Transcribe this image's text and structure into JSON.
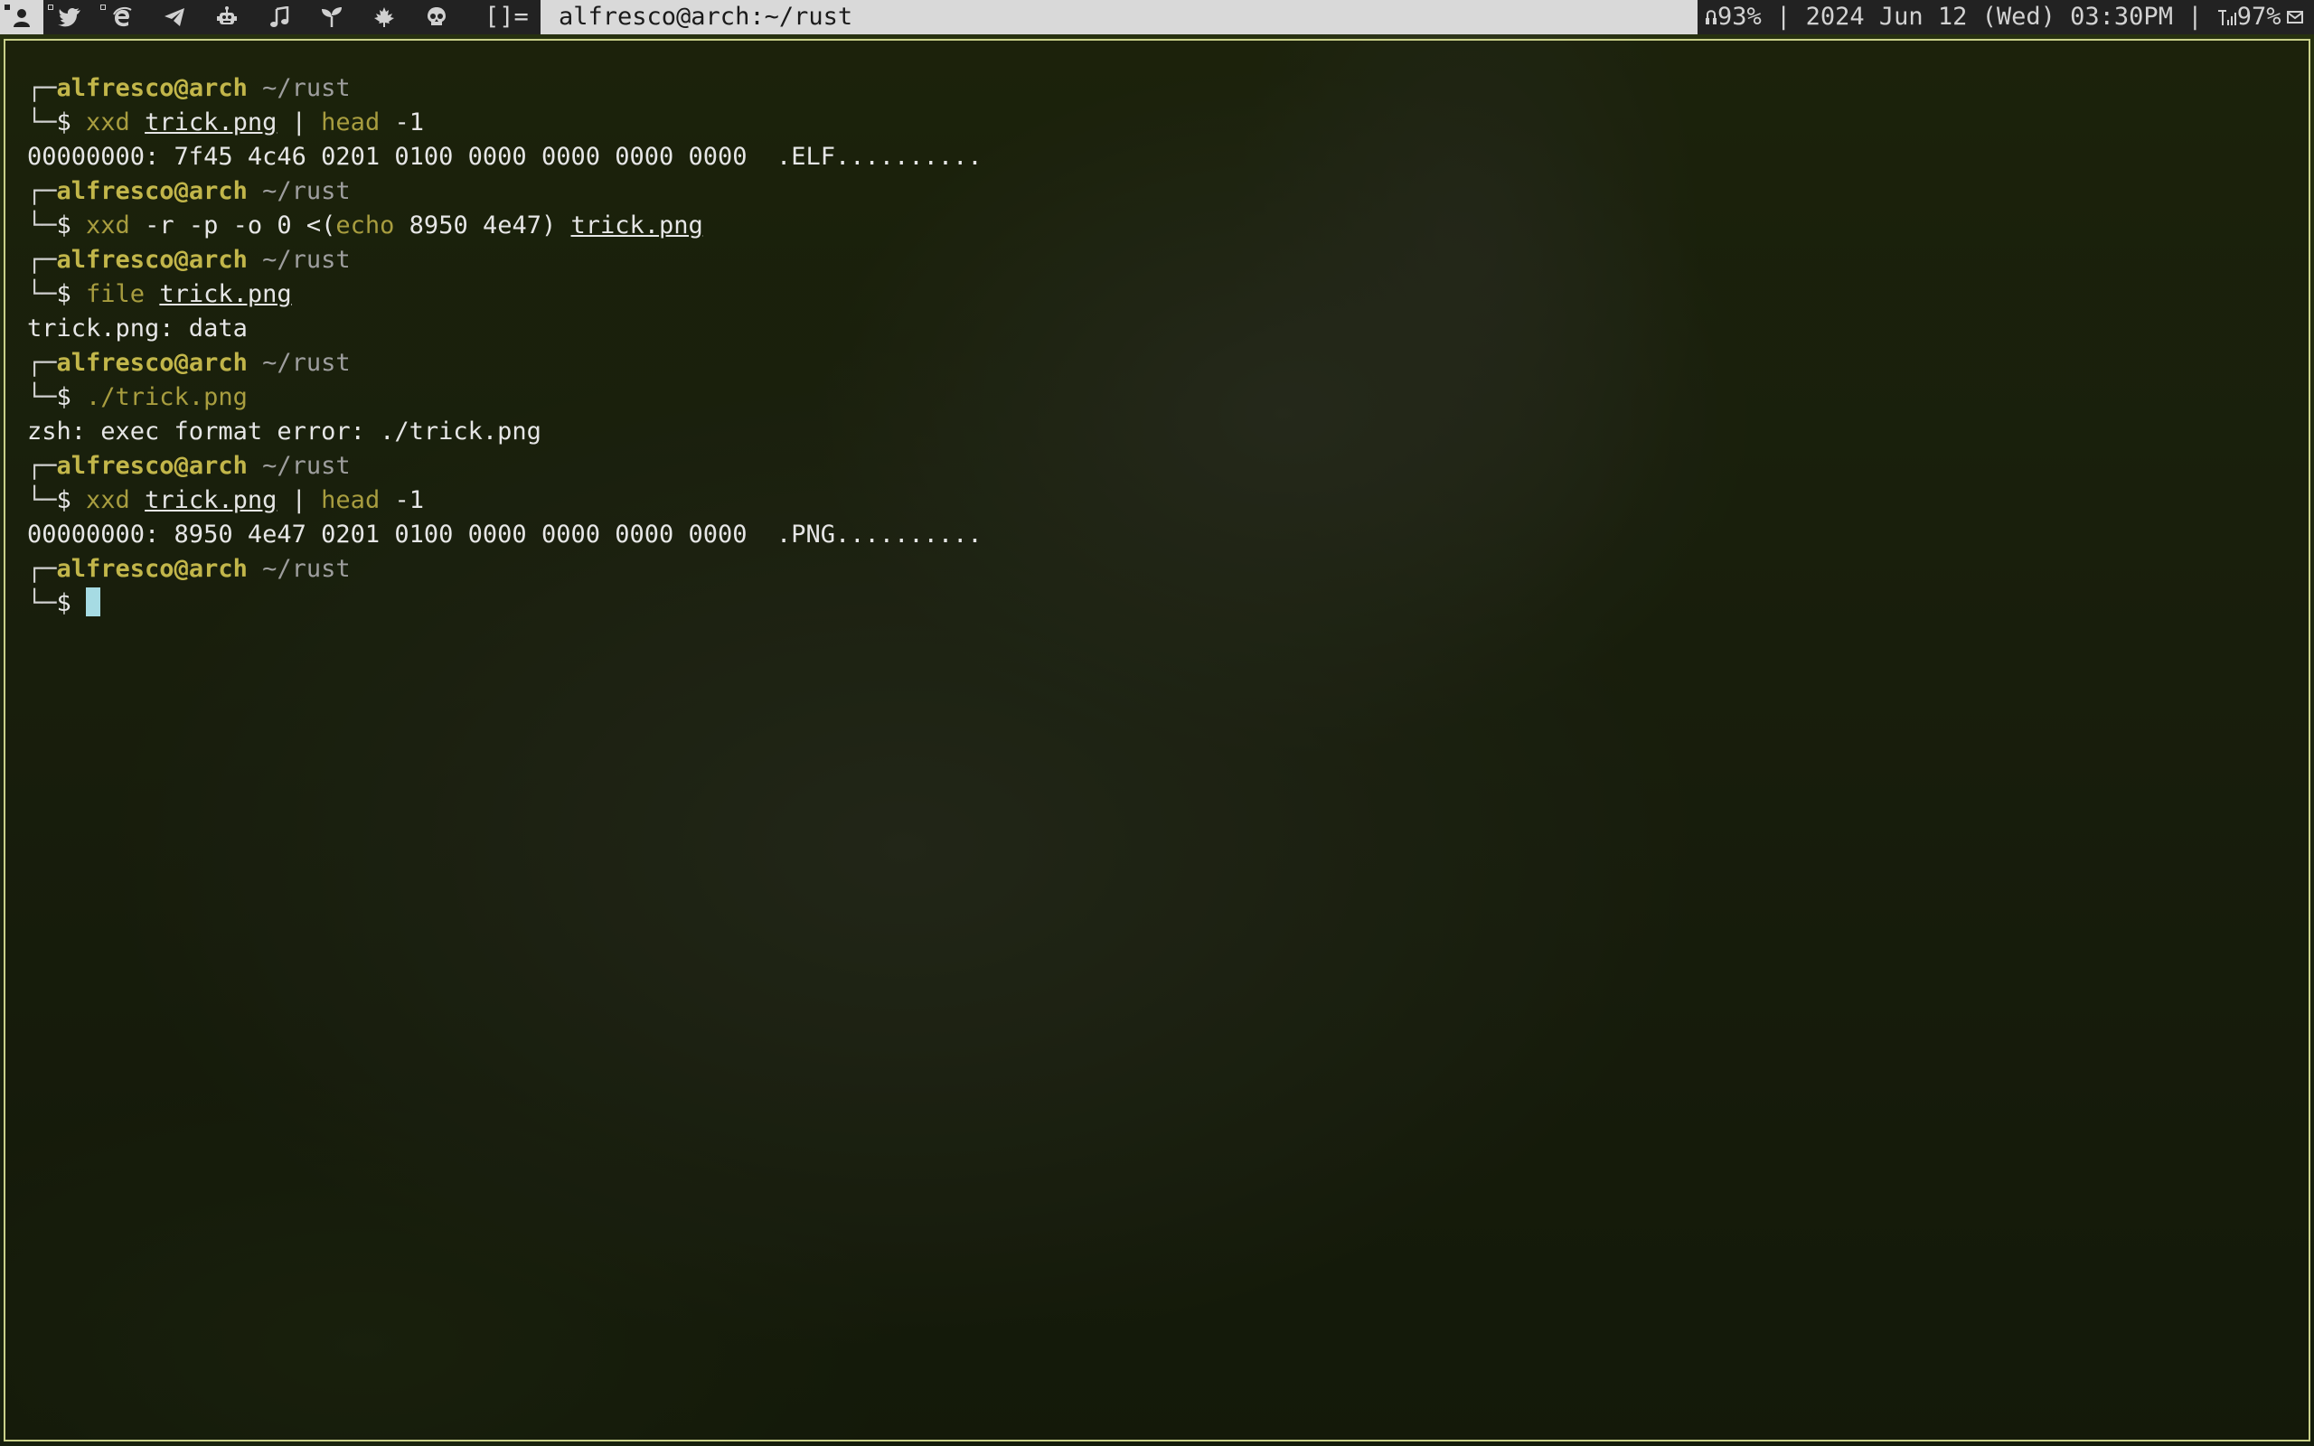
{
  "bar": {
    "tags": [
      {
        "icon": "user-icon",
        "selected": true
      },
      {
        "icon": "bird-icon"
      },
      {
        "icon": "browser-e-icon"
      },
      {
        "icon": "paper-plane-icon"
      },
      {
        "icon": "robot-icon"
      },
      {
        "icon": "music-note-icon"
      },
      {
        "icon": "sprout-icon"
      },
      {
        "icon": "maple-leaf-icon"
      },
      {
        "icon": "skull-icon"
      }
    ],
    "layout_symbol": "[]=",
    "window_title": "alfresco@arch:~/rust",
    "status": {
      "volume": "93%",
      "separator1": " | ",
      "datetime": "2024 Jun 12 (Wed) 03:30PM",
      "separator2": " | ",
      "battery": "97%"
    }
  },
  "terminal": {
    "prompt": {
      "box_top": "┌─",
      "box_bottom": "└─",
      "user_host": "alfresco@arch",
      "cwd": "~/rust",
      "symbol": "$"
    },
    "entries": [
      {
        "cmd": {
          "prog": "xxd",
          "rest": [
            {
              "t": " "
            },
            {
              "t": "trick.png",
              "k": "path"
            },
            {
              "t": " | "
            },
            {
              "t": "head",
              "k": "cmd"
            },
            {
              "t": " -1"
            }
          ]
        },
        "output": [
          "00000000: 7f45 4c46 0201 0100 0000 0000 0000 0000  .ELF.........."
        ]
      },
      {
        "cmd": {
          "prog": "xxd",
          "rest": [
            {
              "t": " -r -p -o 0 <("
            },
            {
              "t": "echo",
              "k": "cmd"
            },
            {
              "t": " 8950 4e47) "
            },
            {
              "t": "trick.png",
              "k": "path"
            }
          ]
        },
        "output": []
      },
      {
        "cmd": {
          "prog": "file",
          "rest": [
            {
              "t": " "
            },
            {
              "t": "trick.png",
              "k": "path"
            }
          ]
        },
        "output": [
          "trick.png: data"
        ]
      },
      {
        "cmd": {
          "prog": "./trick.png",
          "rest": []
        },
        "output": [
          "zsh: exec format error: ./trick.png"
        ]
      },
      {
        "cmd": {
          "prog": "xxd",
          "rest": [
            {
              "t": " "
            },
            {
              "t": "trick.png",
              "k": "path"
            },
            {
              "t": " | "
            },
            {
              "t": "head",
              "k": "cmd"
            },
            {
              "t": " -1"
            }
          ]
        },
        "output": [
          "00000000: 8950 4e47 0201 0100 0000 0000 0000 0000  .PNG.........."
        ]
      }
    ]
  },
  "colors": {
    "bar_bg": "#222222",
    "title_bg": "#d9d9d9",
    "terminal_border": "#c9d089",
    "user_host": "#c2b64a",
    "cwd": "#9e9e9e",
    "command": "#a89d3f",
    "cursor": "#a6dbe3"
  }
}
